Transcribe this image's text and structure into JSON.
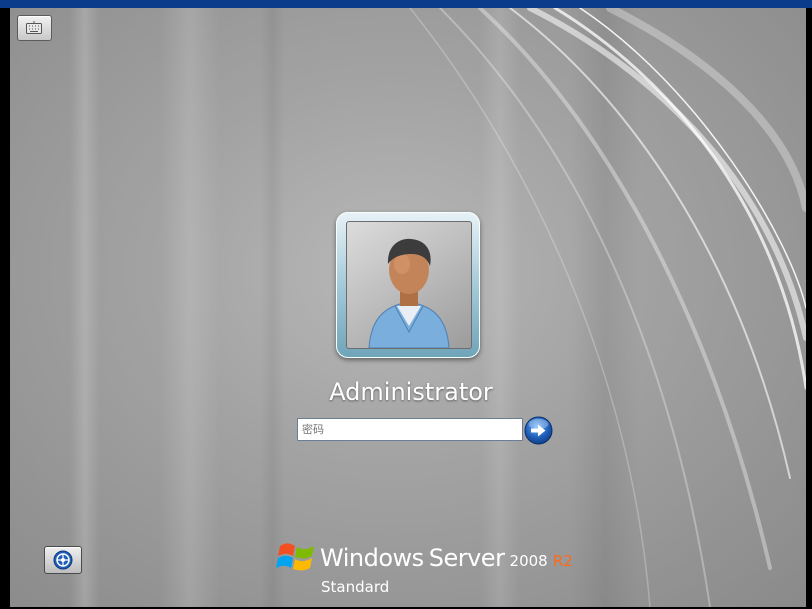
{
  "login": {
    "username": "Administrator",
    "password_placeholder": "密码"
  },
  "branding": {
    "windows": "Windows",
    "server": "Server",
    "year": "2008",
    "release": "R2",
    "edition": "Standard"
  },
  "icons": {
    "keyboard": "keyboard-icon",
    "submit": "arrow-right-icon",
    "ease_of_access": "ease-of-access-icon",
    "user_picture": "user-avatar-icon",
    "logo": "windows-flag-icon"
  },
  "colors": {
    "top_bar": "#0b3c8c",
    "background": "#a3a3a3",
    "username_text": "#ffffff",
    "release_accent": "#ff6a1a",
    "submit_button": "#1f5fb8"
  }
}
